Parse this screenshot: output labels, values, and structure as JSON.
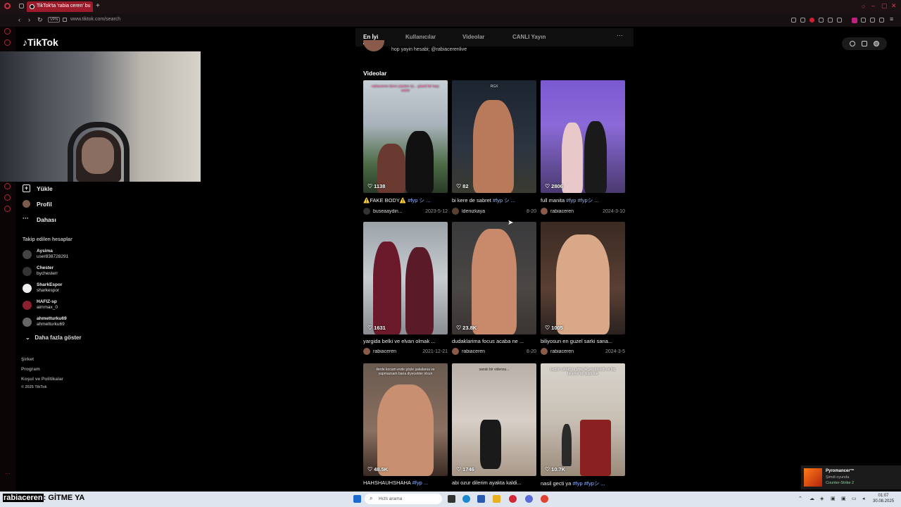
{
  "browser": {
    "tab_title": "TikTok'ta 'rabia ceren' bu",
    "new_tab": "+",
    "url": "www.tiktok.com/search",
    "vpn": "VPN"
  },
  "tiktok": {
    "logo": "TikTok",
    "menu": [
      {
        "label": "Yükle",
        "icon": "plus-square-icon"
      },
      {
        "label": "Profil",
        "icon": "avatar-icon"
      },
      {
        "label": "Dahası",
        "icon": "more-icon"
      }
    ],
    "following_header": "Takip edilen hesaplar",
    "accounts": [
      {
        "name": "Aysima",
        "handle": "user838728291"
      },
      {
        "name": "Chester",
        "handle": "bychesterr"
      },
      {
        "name": "SharkEspor",
        "handle": "sharkespor"
      },
      {
        "name": "HAFIZ-sp",
        "handle": "aimmax_0"
      },
      {
        "name": "ahmetturku69",
        "handle": "ahmetturku69"
      }
    ],
    "show_more": "Daha fazla göster",
    "footer": [
      "Şirket",
      "Program",
      "Koşul ve Politikalar",
      "© 2025 TikTok"
    ]
  },
  "search": {
    "tabs": [
      "En İyi",
      "Kullanıcılar",
      "Videolar",
      "CANLI Yayın"
    ],
    "more": "···",
    "top_text": "hop yayin hesabi; @rabiacerenlive",
    "videos_header": "Videolar",
    "videos": [
      {
        "likes": "1138",
        "title": "⚠️FAKE BODY⚠️ ",
        "tag": "#fyp シ ...",
        "user": "buseaaydin...",
        "date": "2023-5-12",
        "caption": "rabiaceren ikinci yüzden içi... güzeli bir kaşı vardır"
      },
      {
        "likes": "82",
        "title": "bi kere de sabret ",
        "tag": "#fyp シ ...",
        "user": "ldenizkaya",
        "date": "8-20",
        "caption": "RGX"
      },
      {
        "likes": "2806",
        "title": "full manita ",
        "tag": "#fyp #fypシ ...",
        "user": "rabiaceren",
        "date": "2024-3-10",
        "caption": ""
      },
      {
        "likes": "1631",
        "title": "yargida belki ve elvan olmak ...",
        "tag": "",
        "user": "rabiaceren",
        "date": "2021-12-21",
        "caption": ""
      },
      {
        "likes": "23.8K",
        "title": "dudaklarima focus acaba ne ...",
        "tag": "",
        "user": "rabiaceren",
        "date": "8-20",
        "caption": ""
      },
      {
        "likes": "1005",
        "title": "biliyosun en guzel sarki sana...",
        "tag": "",
        "user": "rabiaceren",
        "date": "2024-3-5",
        "caption": ""
      },
      {
        "likes": "48.5K",
        "title": "HAHSHAUHSHAHA ",
        "tag": "#fyp ...",
        "user": "",
        "date": "",
        "caption": "ilerde kocam evde şöyle şakalarsa ve yapmazsam bana diyecekler olsun"
      },
      {
        "likes": "1746",
        "title": "abi ozur dilerim ayakta kaldi...",
        "tag": "",
        "user": "",
        "date": "",
        "caption": "sanslı bir videosu..."
      },
      {
        "likes": "10.7K",
        "title": "nasil gecti ya ",
        "tag": "#fyp #fypシ ...",
        "user": "",
        "date": "",
        "caption": "bugün sabah su diye bir yer tıkandı ve hiç binerler ilk doktorlar"
      }
    ]
  },
  "toast": {
    "game_name": "Pyromancer™",
    "status": "Şimdi oyunda",
    "game": "Counter-Strike 2"
  },
  "taskbar": {
    "streamer_name": "rabiaceren",
    "streamer_sep": ": ",
    "streamer_msg": "GİTME YA",
    "search_placeholder": "Hızlı arama",
    "time": "01:07",
    "date": "30.08.2025"
  }
}
